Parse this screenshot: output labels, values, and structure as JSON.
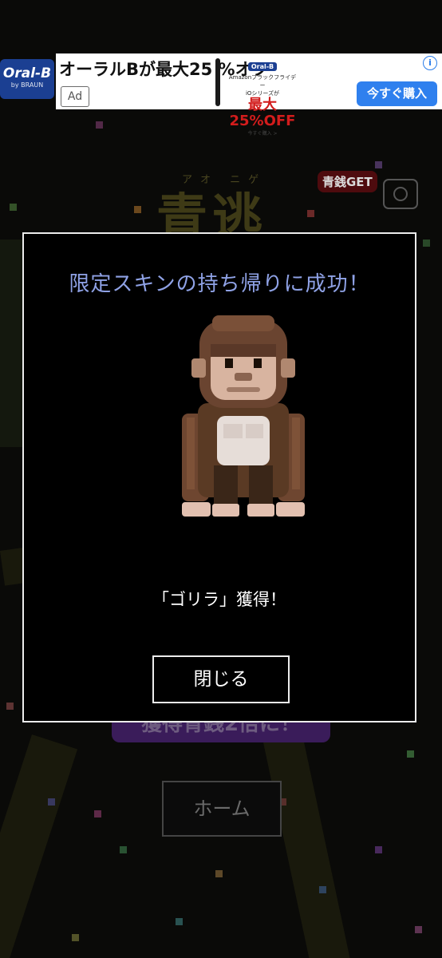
{
  "ad": {
    "logo_brand": "Oral-B",
    "logo_sub": "by BRAUN",
    "headline": "オーラルBが最大25 %オフ",
    "badge": "Ad",
    "promo_brand": "Oral-B",
    "promo_line1": "Amazonブラックフライデー",
    "promo_line2": "iOシリーズが",
    "promo_percent": "最大25%OFF",
    "promo_line3": "今すぐ購入 >",
    "cta": "今すぐ購入",
    "info_icon": "i"
  },
  "background": {
    "title": "青逃",
    "title_ruby": "アオ ニゲ",
    "get_badge": "青銭GET",
    "purple_button": "獲得青銭2倍に！",
    "home_button": "ホーム"
  },
  "modal": {
    "title": "限定スキンの持ち帰りに成功！",
    "obtained": "「ゴリラ」獲得！",
    "close": "閉じる",
    "skin_icon": "gorilla-icon"
  },
  "colors": {
    "modal_title": "#8fa2e6",
    "ad_cta": "#2f80ee",
    "brand_blue": "#1b3f92"
  }
}
